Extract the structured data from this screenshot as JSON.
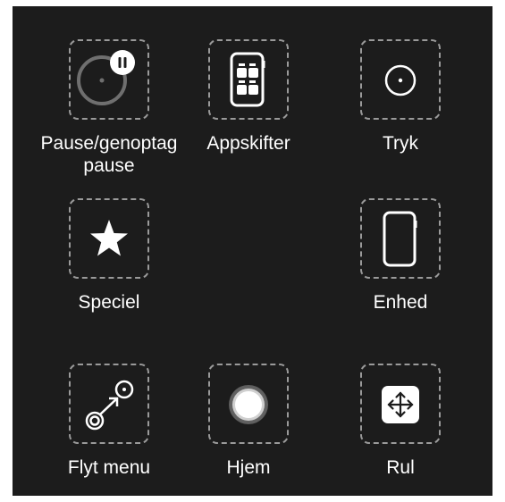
{
  "menu": {
    "items": [
      {
        "id": "pause",
        "label": "Pause/genoptag\npause",
        "icon": "pause-resume-icon"
      },
      {
        "id": "app-switcher",
        "label": "Appskifter",
        "icon": "app-switcher-icon"
      },
      {
        "id": "tap",
        "label": "Tryk",
        "icon": "tap-icon"
      },
      {
        "id": "custom",
        "label": "Speciel",
        "icon": "star-icon"
      },
      {
        "id": "device",
        "label": "Enhed",
        "icon": "device-icon"
      },
      {
        "id": "move-menu",
        "label": "Flyt menu",
        "icon": "move-menu-icon"
      },
      {
        "id": "home",
        "label": "Hjem",
        "icon": "home-button-icon"
      },
      {
        "id": "scroll",
        "label": "Rul",
        "icon": "scroll-icon"
      }
    ]
  },
  "colors": {
    "background": "#1c1c1c",
    "dashed_border": "#9a9a9a",
    "text": "#ffffff"
  }
}
